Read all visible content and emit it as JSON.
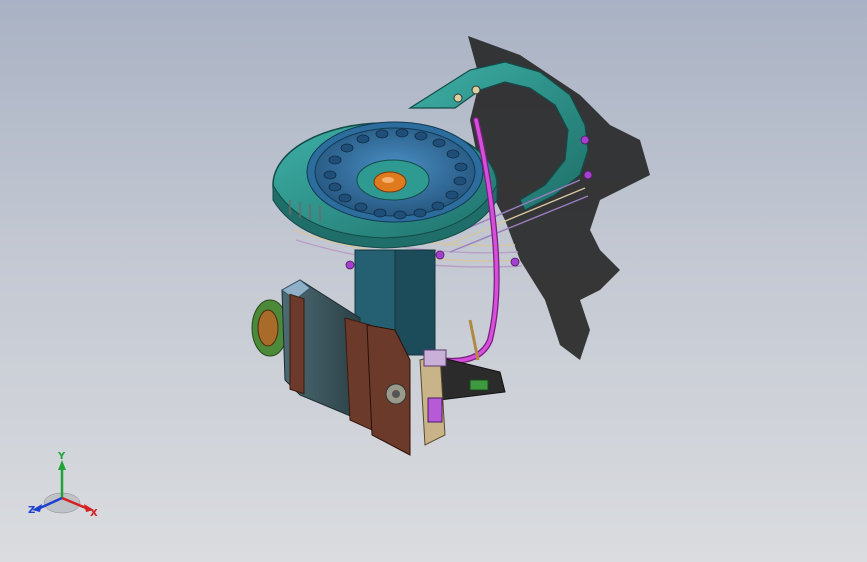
{
  "viewport": {
    "background_top": "#a9b2c4",
    "background_bottom": "#dadcdf"
  },
  "colors": {
    "teal_plate": "#2f9a92",
    "teal_dark": "#1f6e6a",
    "blue_dial": "#3f83b8",
    "orange_hub": "#e07a1f",
    "magenta_tube": "#c23fc8",
    "brown_motor": "#6b3a2a",
    "shadow": "#2a2a2a"
  },
  "axis_triad": {
    "x_label": "X",
    "y_label": "Y",
    "z_label": "Z",
    "x_color": "#d42020",
    "y_color": "#22a33a",
    "z_color": "#1f3fd0"
  }
}
